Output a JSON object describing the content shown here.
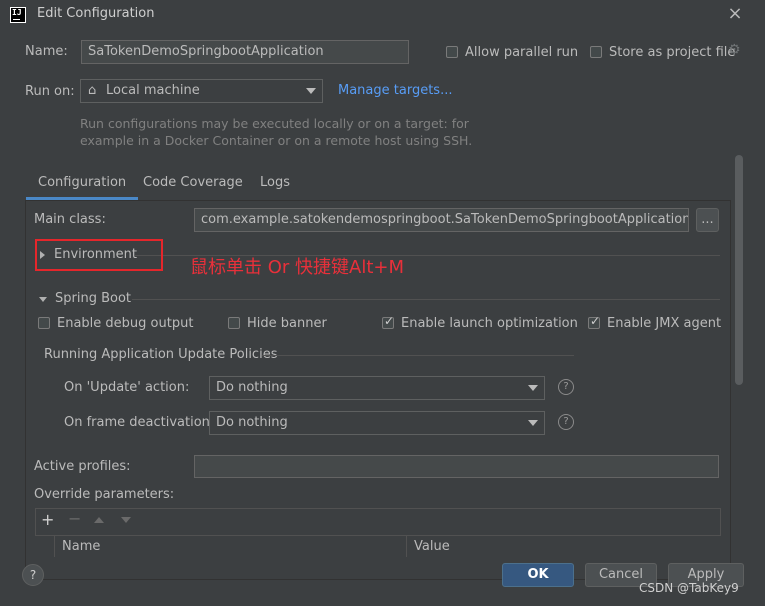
{
  "window": {
    "title": "Edit Configuration",
    "close_icon": "×"
  },
  "name_row": {
    "name_label": "Name:",
    "name_value": "SaTokenDemoSpringbootApplication",
    "allow_parallel_label": "Allow parallel run",
    "store_as_project_label": "Store as project file"
  },
  "run_on": {
    "label": "Run on:",
    "value": "Local machine",
    "manage_targets": "Manage targets...",
    "hint_line1": "Run configurations may be executed locally or on a target: for",
    "hint_line2": "example in a Docker Container or on a remote host using SSH."
  },
  "tabs": [
    {
      "label": "Configuration"
    },
    {
      "label": "Code Coverage"
    },
    {
      "label": "Logs"
    }
  ],
  "configuration": {
    "main_class_label": "Main class:",
    "main_class_value": "com.example.satokendemospringboot.SaTokenDemoSpringbootApplication",
    "browse_label": "...",
    "environment_label": "Environment",
    "annotation": "鼠标单击 Or 快捷键Alt+M",
    "spring_boot_label": "Spring Boot",
    "checkboxes": {
      "debug_output": "Enable debug output",
      "hide_banner": "Hide banner",
      "launch_optimization": "Enable launch optimization",
      "jmx_agent": "Enable JMX agent"
    },
    "update_policies_label": "Running Application Update Policies",
    "on_update_label": "On 'Update' action:",
    "on_update_value": "Do nothing",
    "on_frame_label": "On frame deactivation:",
    "on_frame_value": "Do nothing",
    "active_profiles_label": "Active profiles:",
    "active_profiles_value": "",
    "override_params_label": "Override parameters:",
    "table_columns": {
      "name": "Name",
      "value": "Value"
    }
  },
  "buttons": {
    "ok": "OK",
    "cancel": "Cancel",
    "apply": "Apply"
  },
  "watermark": "CSDN @TabKey9",
  "colors": {
    "accent": "#365880",
    "link": "#589df6",
    "annotation": "#e5262b"
  }
}
